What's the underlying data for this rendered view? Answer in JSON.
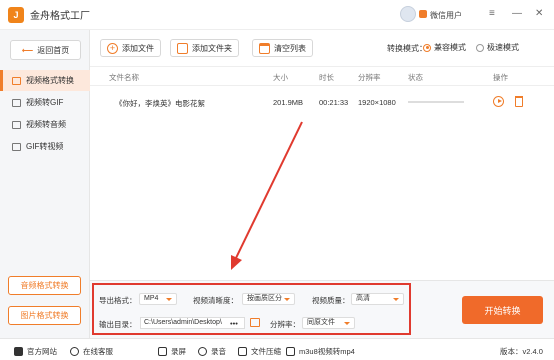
{
  "app": {
    "title": "金舟格式工厂",
    "user": "微信用户"
  },
  "sidebar": {
    "home": "返回首页",
    "items": [
      {
        "label": "视频格式转换"
      },
      {
        "label": "视频转GIF"
      },
      {
        "label": "视频转音频"
      },
      {
        "label": "GIF转视频"
      }
    ],
    "bottom_buttons": [
      "音频格式转换",
      "图片格式转换"
    ]
  },
  "toolbar": {
    "add_file": "添加文件",
    "add_folder": "添加文件夹",
    "clear_list": "清空列表",
    "mode_label": "转换模式：",
    "mode_compat": "兼容模式",
    "mode_fast": "极速模式",
    "selected_mode": "兼容模式"
  },
  "table": {
    "headers": [
      "文件名称",
      "大小",
      "时长",
      "分辨率",
      "状态",
      "操作"
    ],
    "rows": [
      {
        "name": "《你好，李焕英》电影花絮",
        "size": "201.9MB",
        "duration": "00:21:33",
        "resolution": "1920×1080"
      }
    ]
  },
  "settings": {
    "format_label": "导出格式：",
    "format_value": "MP4",
    "clarity_label": "视频清晰度：",
    "clarity_value": "按画质区分",
    "quality_label": "视频质量：",
    "quality_value": "高清",
    "output_label": "输出目录：",
    "output_value": "C:\\Users\\admin\\Desktop\\",
    "more": "•••",
    "resolution_label": "分辨率：",
    "resolution_value": "同原文件",
    "start": "开始转换"
  },
  "statusbar": {
    "website": "官方网站",
    "service": "在线客服",
    "tools": [
      "录屏",
      "录音",
      "文件压缩",
      "m3u8视频转mp4"
    ],
    "version": "版本：v2.4.0"
  },
  "colors": {
    "accent": "#f07d2a",
    "annotation": "#e03a2f"
  }
}
